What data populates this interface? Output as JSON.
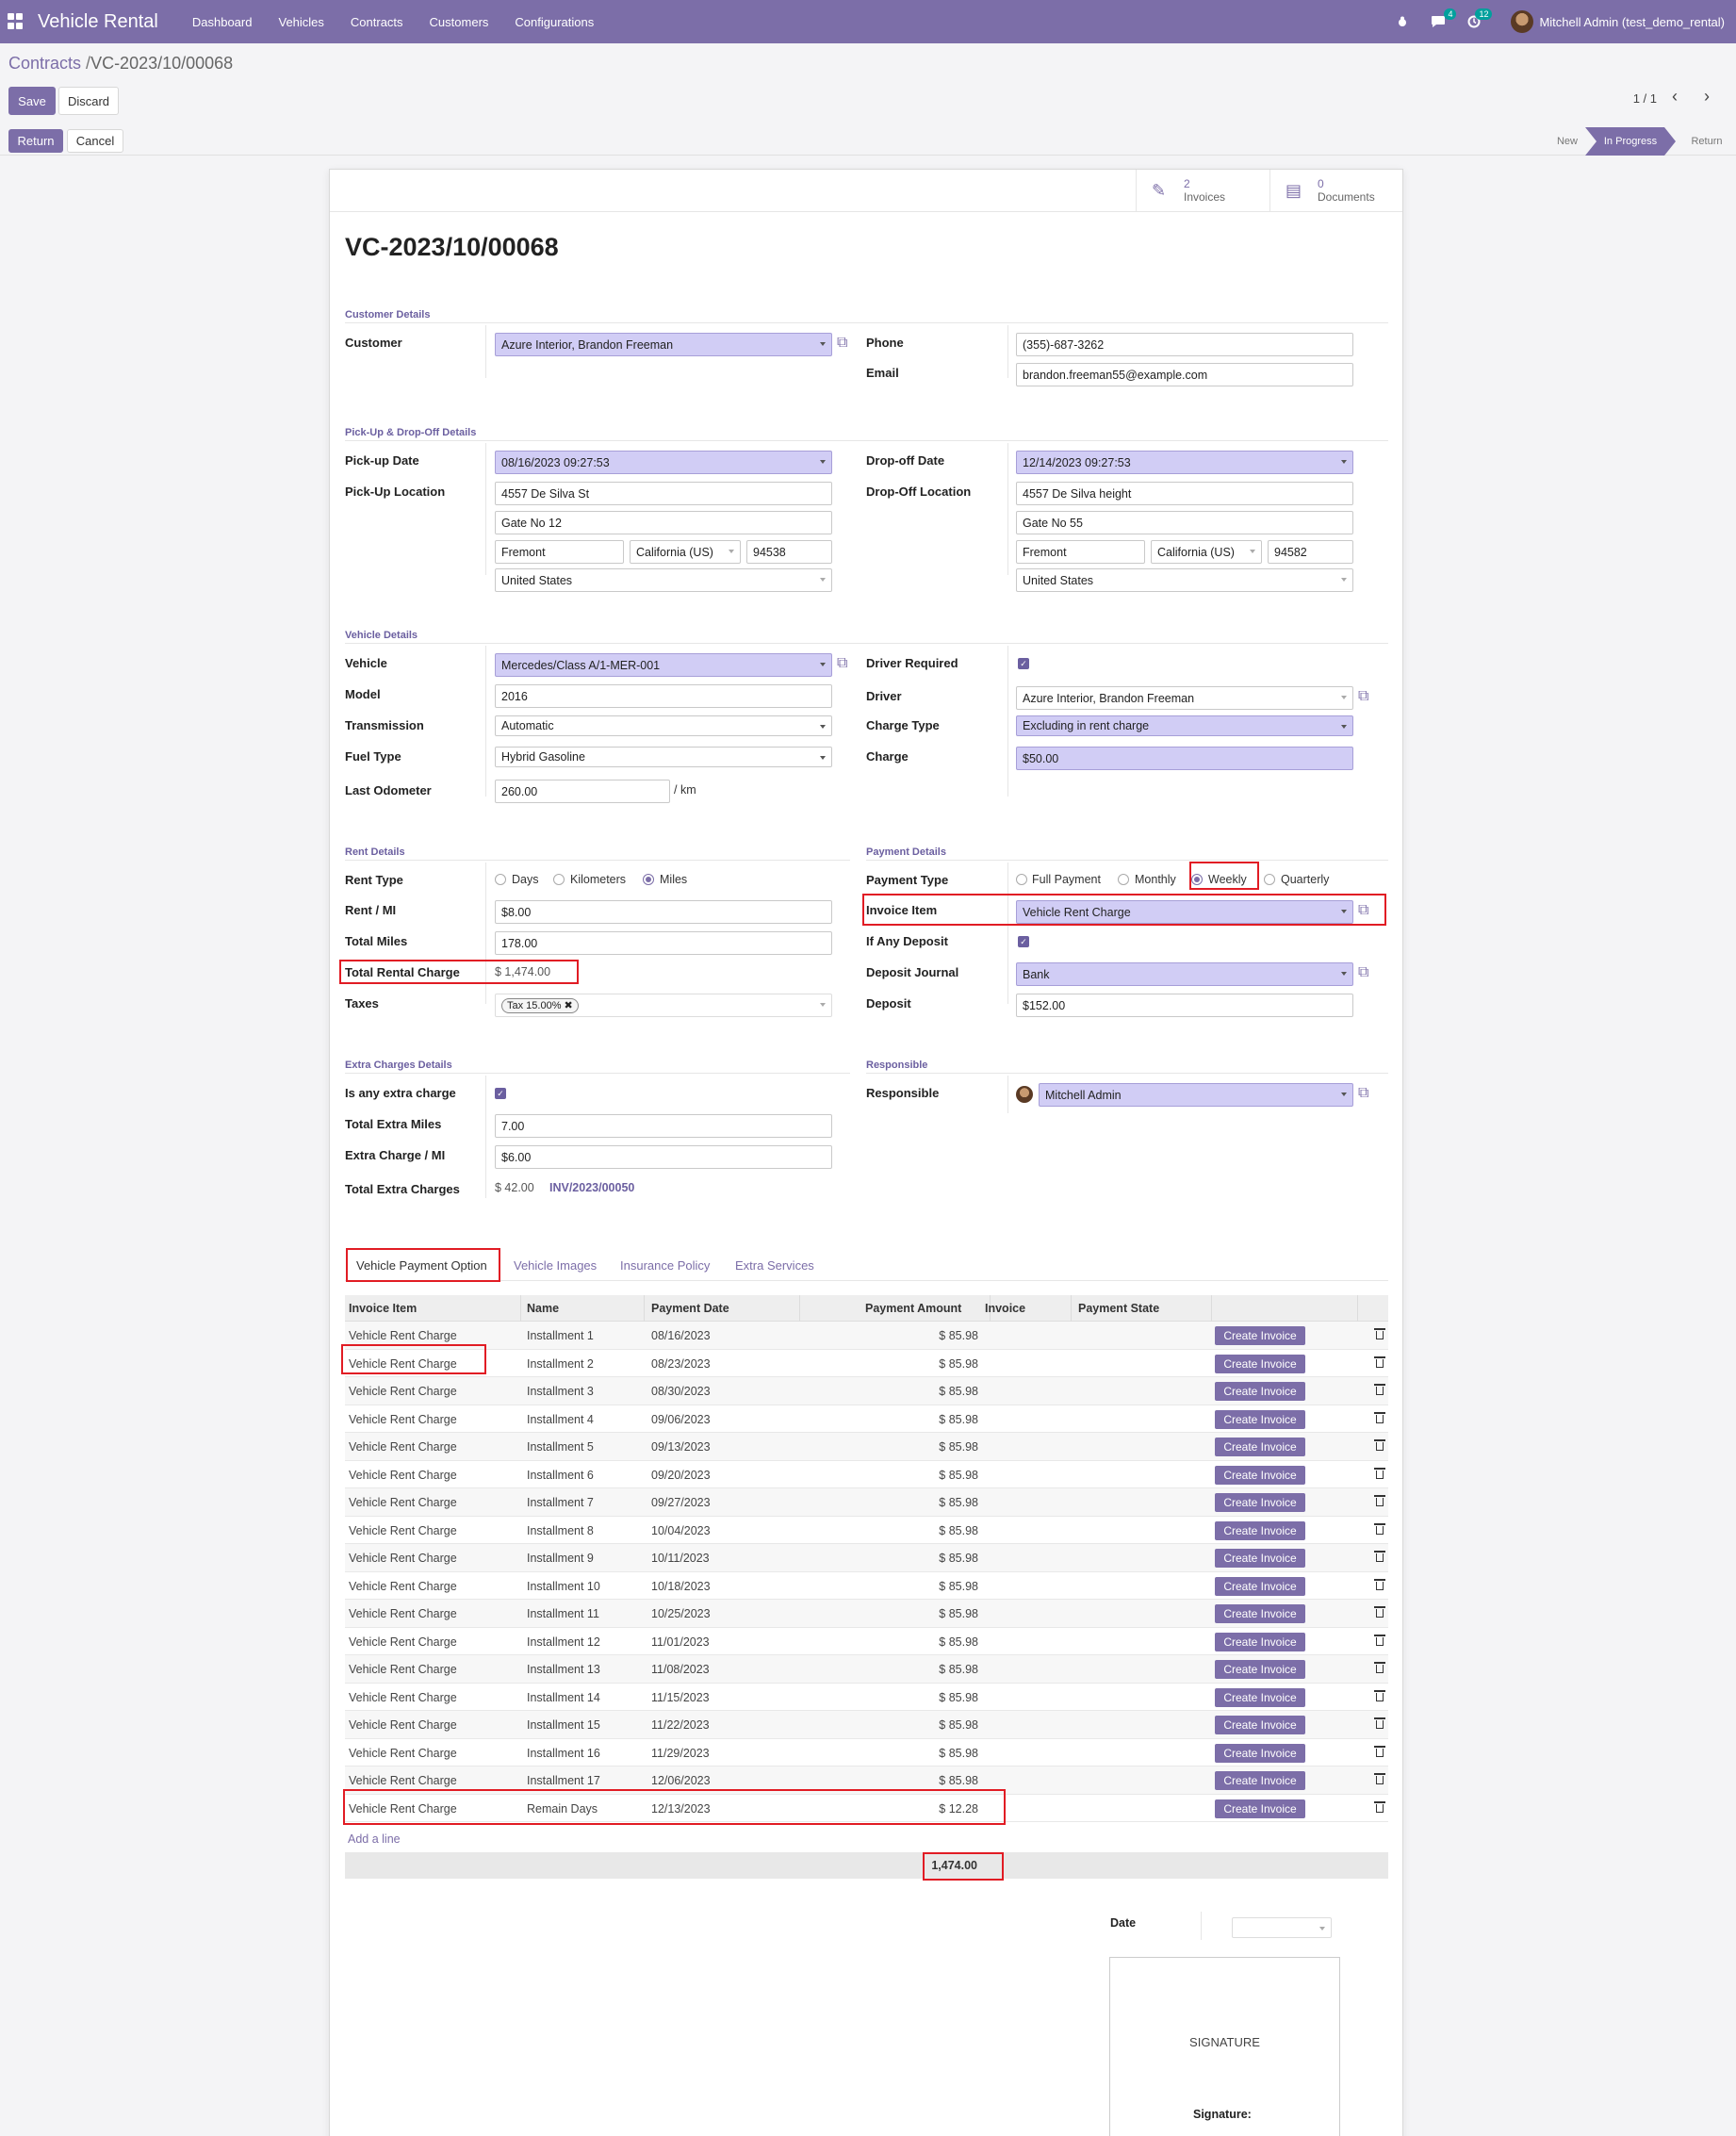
{
  "navbar": {
    "app_title": "Vehicle Rental",
    "menu": [
      "Dashboard",
      "Vehicles",
      "Contracts",
      "Customers",
      "Configurations"
    ],
    "activity_badge": "4",
    "messages_badge": "12",
    "user": "Mitchell Admin (test_demo_rental)"
  },
  "breadcrumb": {
    "parent": "Contracts",
    "separator": "/",
    "current": "VC-2023/10/00068"
  },
  "actions": {
    "save": "Save",
    "discard": "Discard",
    "return": "Return",
    "cancel": "Cancel"
  },
  "pager": {
    "value": "1 / 1"
  },
  "statusbar": {
    "stages": [
      "New",
      "In Progress",
      "Return"
    ],
    "active": "In Progress"
  },
  "smart_buttons": {
    "invoices": {
      "count": "2",
      "label": "Invoices"
    },
    "documents": {
      "count": "0",
      "label": "Documents"
    }
  },
  "record": {
    "name": "VC-2023/10/00068"
  },
  "customer_details": {
    "title": "Customer Details",
    "customer_label": "Customer",
    "customer": "Azure Interior, Brandon Freeman",
    "phone_label": "Phone",
    "phone": "(355)-687-3262",
    "email_label": "Email",
    "email": "brandon.freeman55@example.com"
  },
  "pickup_dropoff": {
    "title": "Pick-Up & Drop-Off Details",
    "pickup_date_label": "Pick-up Date",
    "pickup_date": "08/16/2023 09:27:53",
    "pickup_location_label": "Pick-Up Location",
    "pickup_street": "4557 De Silva St",
    "pickup_street2": "Gate No 12",
    "pickup_city": "Fremont",
    "pickup_state": "California (US)",
    "pickup_zip": "94538",
    "pickup_country": "United States",
    "dropoff_date_label": "Drop-off Date",
    "dropoff_date": "12/14/2023 09:27:53",
    "dropoff_location_label": "Drop-Off Location",
    "dropoff_street": "4557 De Silva height",
    "dropoff_street2": "Gate No 55",
    "dropoff_city": "Fremont",
    "dropoff_state": "California (US)",
    "dropoff_zip": "94582",
    "dropoff_country": "United States"
  },
  "vehicle_details": {
    "title": "Vehicle Details",
    "vehicle_label": "Vehicle",
    "vehicle": "Mercedes/Class A/1-MER-001",
    "model_label": "Model",
    "model": "2016",
    "transmission_label": "Transmission",
    "transmission": "Automatic",
    "fuel_label": "Fuel Type",
    "fuel": "Hybrid Gasoline",
    "odometer_label": "Last Odometer",
    "odometer": "260.00",
    "odometer_unit": "/ km",
    "driver_required_label": "Driver Required",
    "driver_required": true,
    "driver_label": "Driver",
    "driver": "Azure Interior, Brandon Freeman",
    "charge_type_label": "Charge Type",
    "charge_type": "Excluding in rent charge",
    "charge_label": "Charge",
    "charge": "$50.00"
  },
  "rent_details": {
    "title": "Rent Details",
    "rent_type_label": "Rent Type",
    "rent_type_options": [
      "Days",
      "Kilometers",
      "Miles"
    ],
    "rent_type_selected": "Miles",
    "rent_per_label": "Rent / MI",
    "rent_per": "$8.00",
    "total_miles_label": "Total Miles",
    "total_miles": "178.00",
    "total_rental_label": "Total Rental Charge",
    "total_rental": "$ 1,474.00",
    "taxes_label": "Taxes",
    "tax_tag": "Tax 15.00%"
  },
  "payment_details": {
    "title": "Payment Details",
    "payment_type_label": "Payment Type",
    "payment_type_options": [
      "Full Payment",
      "Monthly",
      "Weekly",
      "Quarterly"
    ],
    "payment_type_selected": "Weekly",
    "invoice_item_label": "Invoice Item",
    "invoice_item": "Vehicle Rent Charge",
    "deposit_flag_label": "If Any Deposit",
    "deposit_flag": true,
    "deposit_journal_label": "Deposit Journal",
    "deposit_journal": "Bank",
    "deposit_label": "Deposit",
    "deposit": "$152.00"
  },
  "extra_charges": {
    "title": "Extra Charges Details",
    "extra_flag_label": "Is any extra charge",
    "extra_flag": true,
    "extra_miles_label": "Total Extra Miles",
    "extra_miles": "7.00",
    "extra_per_label": "Extra Charge / MI",
    "extra_per": "$6.00",
    "total_extra_label": "Total Extra Charges",
    "total_extra": "$ 42.00",
    "extra_invoice": "INV/2023/00050"
  },
  "responsible": {
    "title": "Responsible",
    "label": "Responsible",
    "value": "Mitchell Admin"
  },
  "tabs": [
    "Vehicle Payment Option",
    "Vehicle Images",
    "Insurance Policy",
    "Extra Services"
  ],
  "payment_table": {
    "columns": [
      "Invoice Item",
      "Name",
      "Payment Date",
      "Payment Amount",
      "Invoice",
      "Payment State"
    ],
    "button_label": "Create Invoice",
    "rows": [
      [
        "Vehicle Rent Charge",
        "Installment 1",
        "08/16/2023",
        "$ 85.98"
      ],
      [
        "Vehicle Rent Charge",
        "Installment 2",
        "08/23/2023",
        "$ 85.98"
      ],
      [
        "Vehicle Rent Charge",
        "Installment 3",
        "08/30/2023",
        "$ 85.98"
      ],
      [
        "Vehicle Rent Charge",
        "Installment 4",
        "09/06/2023",
        "$ 85.98"
      ],
      [
        "Vehicle Rent Charge",
        "Installment 5",
        "09/13/2023",
        "$ 85.98"
      ],
      [
        "Vehicle Rent Charge",
        "Installment 6",
        "09/20/2023",
        "$ 85.98"
      ],
      [
        "Vehicle Rent Charge",
        "Installment 7",
        "09/27/2023",
        "$ 85.98"
      ],
      [
        "Vehicle Rent Charge",
        "Installment 8",
        "10/04/2023",
        "$ 85.98"
      ],
      [
        "Vehicle Rent Charge",
        "Installment 9",
        "10/11/2023",
        "$ 85.98"
      ],
      [
        "Vehicle Rent Charge",
        "Installment 10",
        "10/18/2023",
        "$ 85.98"
      ],
      [
        "Vehicle Rent Charge",
        "Installment 11",
        "10/25/2023",
        "$ 85.98"
      ],
      [
        "Vehicle Rent Charge",
        "Installment 12",
        "11/01/2023",
        "$ 85.98"
      ],
      [
        "Vehicle Rent Charge",
        "Installment 13",
        "11/08/2023",
        "$ 85.98"
      ],
      [
        "Vehicle Rent Charge",
        "Installment 14",
        "11/15/2023",
        "$ 85.98"
      ],
      [
        "Vehicle Rent Charge",
        "Installment 15",
        "11/22/2023",
        "$ 85.98"
      ],
      [
        "Vehicle Rent Charge",
        "Installment 16",
        "11/29/2023",
        "$ 85.98"
      ],
      [
        "Vehicle Rent Charge",
        "Installment 17",
        "12/06/2023",
        "$ 85.98"
      ],
      [
        "Vehicle Rent Charge",
        "Remain Days",
        "12/13/2023",
        "$ 12.28"
      ]
    ],
    "add_line": "Add a line",
    "total": "1,474.00"
  },
  "signature": {
    "date_label": "Date",
    "placeholder": "SIGNATURE",
    "label": "Signature:"
  },
  "colors": {
    "brand": "#7c6ea8",
    "required_field": "#d1cdf5",
    "highlight": "#e11c24"
  }
}
